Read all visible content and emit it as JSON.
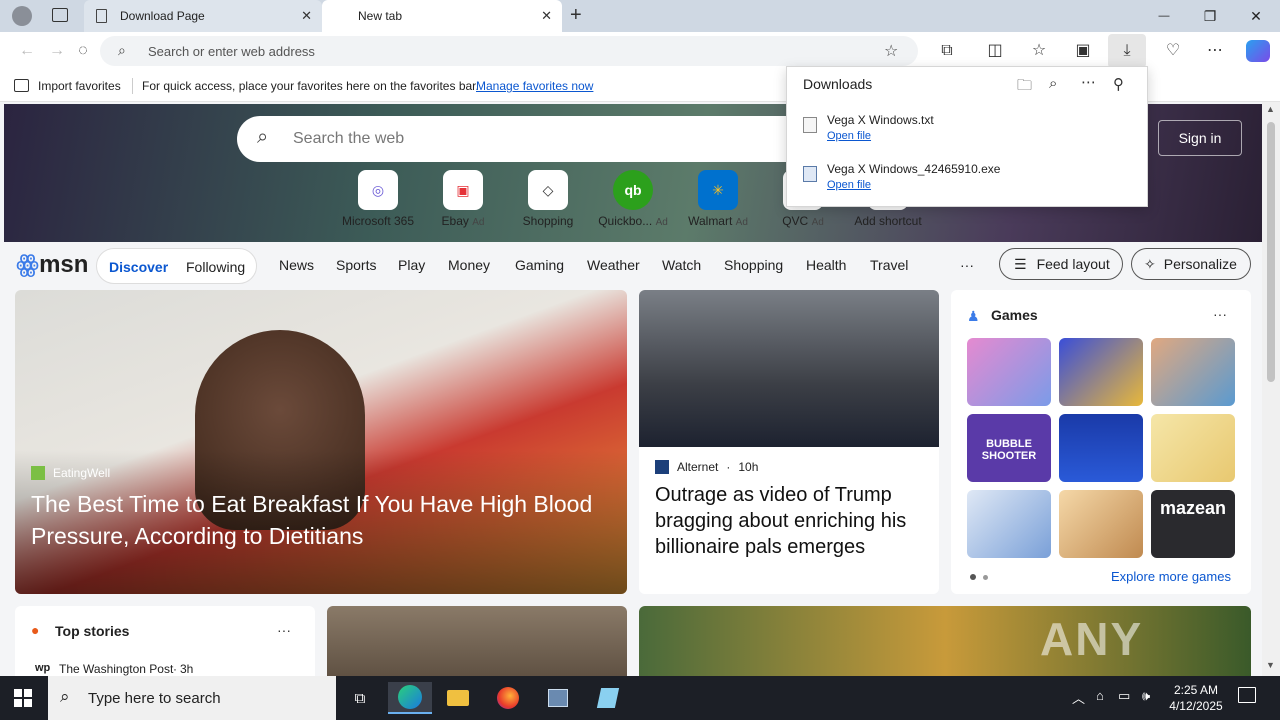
{
  "browser": {
    "tabs": [
      {
        "label": "Download Page",
        "close": "✕"
      },
      {
        "label": "New tab",
        "close": "✕"
      }
    ],
    "new_tab_symbol": "+",
    "window_controls": {
      "minimize": "—",
      "restore": "❐",
      "close": "✕"
    },
    "address_placeholder": "Search or enter web address",
    "favorites_bar": {
      "import_label": "Import favorites",
      "message": "For quick access, place your favorites here on the favorites bar.",
      "manage_link": "Manage favorites now"
    }
  },
  "downloads": {
    "title": "Downloads",
    "items": [
      {
        "name": "Vega X Windows.txt",
        "action": "Open file"
      },
      {
        "name": "Vega X Windows_42465910.exe",
        "action": "Open file"
      }
    ]
  },
  "newtab": {
    "search_placeholder": "Search the web",
    "sign_in": "Sign in",
    "shortcuts": [
      {
        "label": "Microsoft 365",
        "ad": "",
        "glyph": "◎",
        "color": "#6b5bd6"
      },
      {
        "label": "Ebay",
        "ad": "Ad",
        "glyph": "▣",
        "color": "#e53238"
      },
      {
        "label": "Shopping",
        "ad": "",
        "glyph": "◇",
        "color": "#333333"
      },
      {
        "label": "Quickbo...",
        "ad": "Ad",
        "glyph": "qb",
        "color": "#2ca01c"
      },
      {
        "label": "Walmart",
        "ad": "Ad",
        "glyph": "✳",
        "color": "#0071ce"
      },
      {
        "label": "QVC",
        "ad": "Ad",
        "glyph": "Q",
        "color": "#1a1a1a"
      },
      {
        "label": "Add shortcut",
        "ad": "",
        "glyph": "+",
        "color": "#333333"
      }
    ],
    "logo": "msn",
    "nav": {
      "discover": "Discover",
      "following": "Following",
      "items": [
        "News",
        "Sports",
        "Play",
        "Money",
        "Gaming",
        "Weather",
        "Watch",
        "Shopping",
        "Health",
        "Travel"
      ],
      "more": "···",
      "feed_layout": "Feed layout",
      "personalize": "Personalize"
    },
    "hero": {
      "source": "EatingWell",
      "headline": "The Best Time to Eat Breakfast If You Have High Blood Pressure, According to Dietitians"
    },
    "story2": {
      "source": "Alternet",
      "age": "10h",
      "headline": "Outrage as video of Trump bragging about enriching his billionaire pals emerges"
    },
    "games": {
      "title": "Games",
      "more": "···",
      "explore": "Explore more games",
      "tile_labels": [
        "",
        "",
        "",
        "BUBBLE SHOOTER",
        "",
        "",
        "",
        "",
        "mazean"
      ]
    },
    "top_stories": {
      "title": "Top stories",
      "more": "···",
      "source": "The Washington Post",
      "age": "3h"
    },
    "watermark": "ANY RUN"
  },
  "taskbar": {
    "search_placeholder": "Type here to search",
    "time": "2:25 AM",
    "date": "4/12/2025"
  }
}
